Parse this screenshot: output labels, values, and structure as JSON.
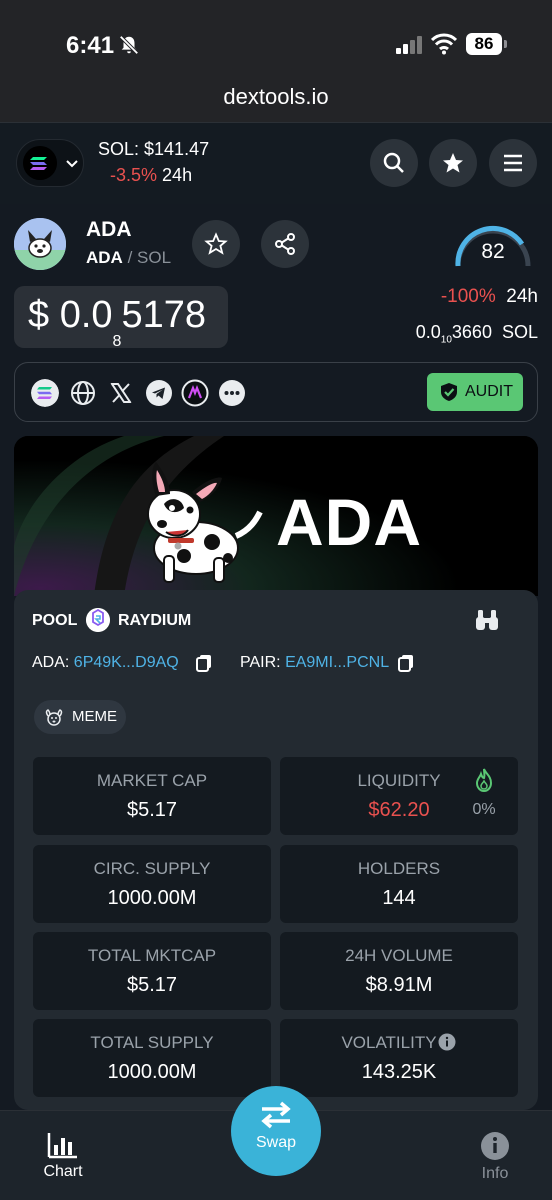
{
  "status_bar": {
    "time": "6:41",
    "battery": "86"
  },
  "browser": {
    "url": "dextools.io"
  },
  "header": {
    "sol_price": "SOL: $141.47",
    "sol_change": "-3.5%",
    "sol_change_period": "24h"
  },
  "token": {
    "name": "ADA",
    "base_symbol": "ADA",
    "separator": "/",
    "quote_symbol": "SOL",
    "score": "82",
    "price_prefix": "$ 0.0",
    "price_subscript": "8",
    "price_digits": "5178",
    "change": "-100%",
    "change_period": "24h",
    "sol_price_prefix": "0.0",
    "sol_price_subscript": "10",
    "sol_price_digits": "3660",
    "sol_unit": "SOL"
  },
  "links": {
    "audit_label": "AUDIT",
    "icons": [
      "solana-icon",
      "globe-icon",
      "x-icon",
      "telegram-icon",
      "dex-icon",
      "more-icon"
    ]
  },
  "banner": {
    "title": "ADA"
  },
  "pool": {
    "label": "POOL",
    "dex_name": "RAYDIUM",
    "token_label": "ADA:",
    "token_address": "6P49K...D9AQ",
    "pair_label": "PAIR:",
    "pair_address": "EA9MI...PCNL",
    "tag": "MEME"
  },
  "stats": [
    {
      "label": "MARKET CAP",
      "value": "$5.17"
    },
    {
      "label": "LIQUIDITY",
      "value": "$62.20",
      "extra": "0%"
    },
    {
      "label": "CIRC. SUPPLY",
      "value": "1000.00M"
    },
    {
      "label": "HOLDERS",
      "value": "144"
    },
    {
      "label": "TOTAL MKTCAP",
      "value": "$5.17"
    },
    {
      "label": "24H VOLUME",
      "value": "$8.91M"
    },
    {
      "label": "TOTAL SUPPLY",
      "value": "1000.00M"
    },
    {
      "label": "VOLATILITY",
      "value": "143.25K"
    }
  ],
  "bottom_nav": {
    "chart": "Chart",
    "swap": "Swap",
    "info": "Info"
  },
  "colors": {
    "negative": "#e9514f",
    "accent": "#3ab3d8",
    "audit": "#5ac774",
    "link": "#4fb3e6"
  }
}
